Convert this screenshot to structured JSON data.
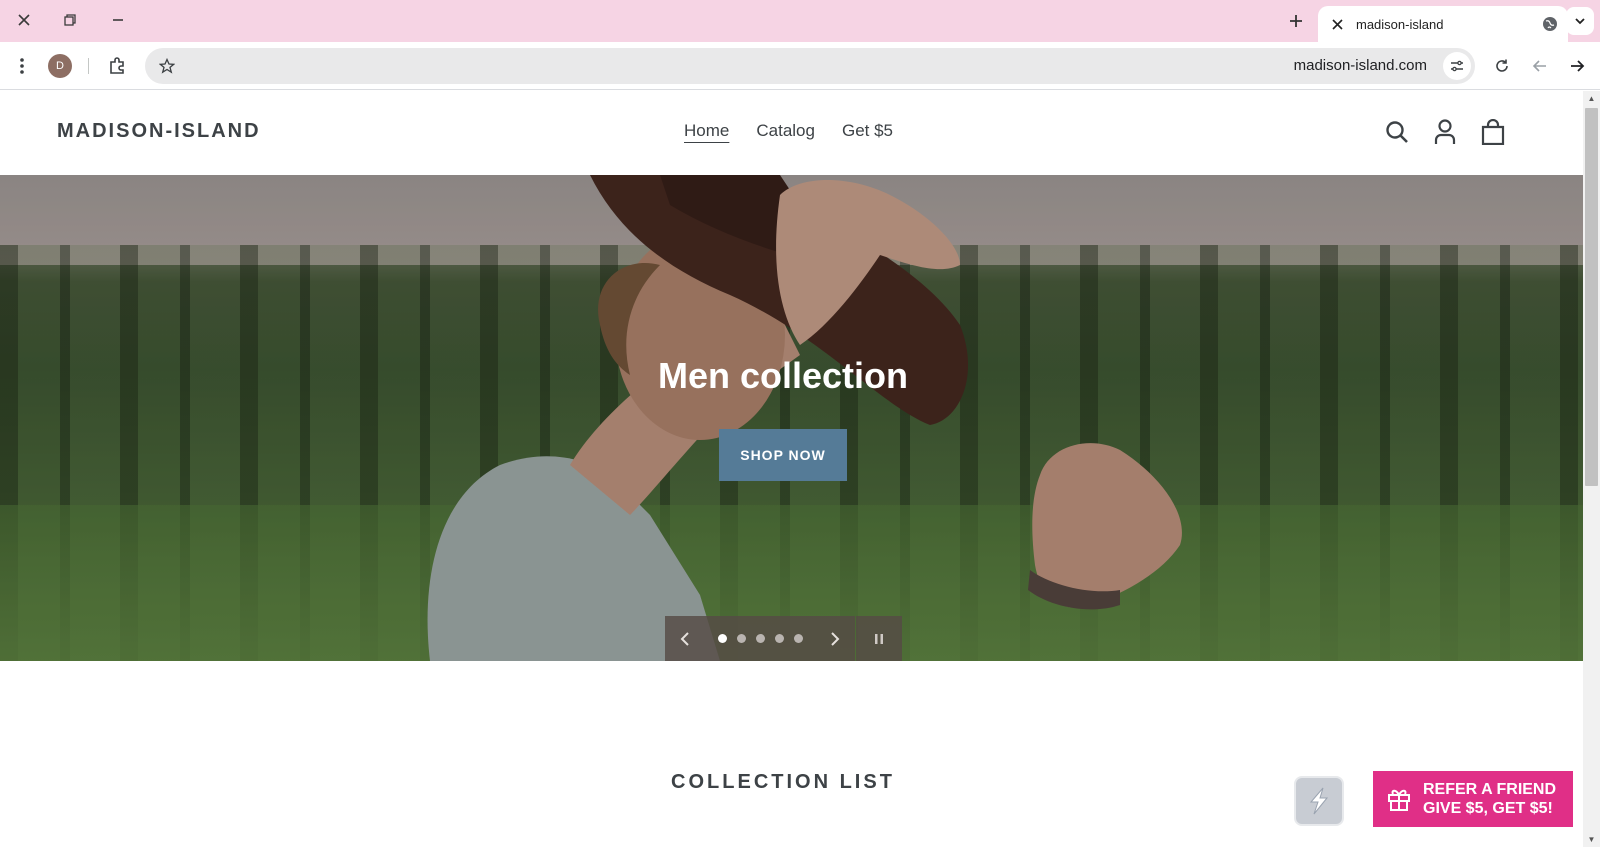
{
  "browser": {
    "tab_title": "madison-island",
    "url": "madison-island.com",
    "profile_initial": "D"
  },
  "site": {
    "logo": "MADISON-ISLAND",
    "nav": [
      {
        "label": "Home",
        "active": true
      },
      {
        "label": "Catalog",
        "active": false
      },
      {
        "label": "Get $5",
        "active": false
      }
    ]
  },
  "hero": {
    "title": "Men collection",
    "button": "SHOP NOW",
    "slides_total": 5,
    "active_slide": 1
  },
  "collection": {
    "heading": "COLLECTION LIST"
  },
  "refer": {
    "line1": "REFER A FRIEND",
    "line2": "GIVE $5, GET $5!"
  },
  "colors": {
    "titlebar": "#f6d4e4",
    "shop_button": "#557b97",
    "refer_button": "#e02f87",
    "text": "#3d4246"
  }
}
